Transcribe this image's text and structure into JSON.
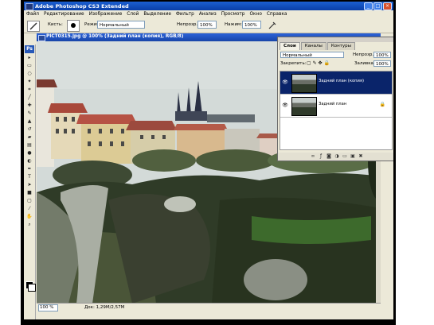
{
  "app": {
    "title": "Adobe Photoshop CS3 Extended"
  },
  "menu": [
    "Файл",
    "Редактирование",
    "Изображение",
    "Слой",
    "Выделение",
    "Фильтр",
    "Анализ",
    "Просмотр",
    "Окно",
    "Справка"
  ],
  "options": {
    "brush_label": "Кисть:",
    "mode_label": "Режим:",
    "mode_value": "Нормальный",
    "opacity_label": "Непрозр.:",
    "opacity_value": "100%",
    "flow_label": "Нажим:",
    "flow_value": "100%"
  },
  "document": {
    "title": "PICT0315.jpg @ 100% (Задний план (копия), RGB/8)",
    "zoom": "100 %",
    "doc_size": "Док: 1,29М/2,57М"
  },
  "layers_panel": {
    "tabs": [
      "Слои",
      "Каналы",
      "Контуры"
    ],
    "blend_mode": "Нормальный",
    "opacity_label": "Непрозр.:",
    "opacity_value": "100%",
    "lock_label": "Закрепить:",
    "fill_label": "Заливка:",
    "fill_value": "100%",
    "layers": [
      {
        "name": "Задний план (копия)",
        "selected": true
      },
      {
        "name": "Задний план",
        "selected": false
      }
    ]
  },
  "tools": [
    "move-tool",
    "marquee-tool",
    "lasso-tool",
    "magic-wand-tool",
    "crop-tool",
    "slice-tool",
    "healing-tool",
    "brush-tool",
    "stamp-tool",
    "history-brush-tool",
    "eraser-tool",
    "gradient-tool",
    "blur-tool",
    "dodge-tool",
    "pen-tool",
    "type-tool",
    "path-select-tool",
    "shape-tool",
    "notes-tool",
    "eyedropper-tool",
    "hand-tool",
    "zoom-tool"
  ],
  "colors": {
    "title_bar": "#0a3fa8",
    "selected_layer": "#0a246a",
    "foreground": "#000000",
    "background": "#ffffff"
  }
}
